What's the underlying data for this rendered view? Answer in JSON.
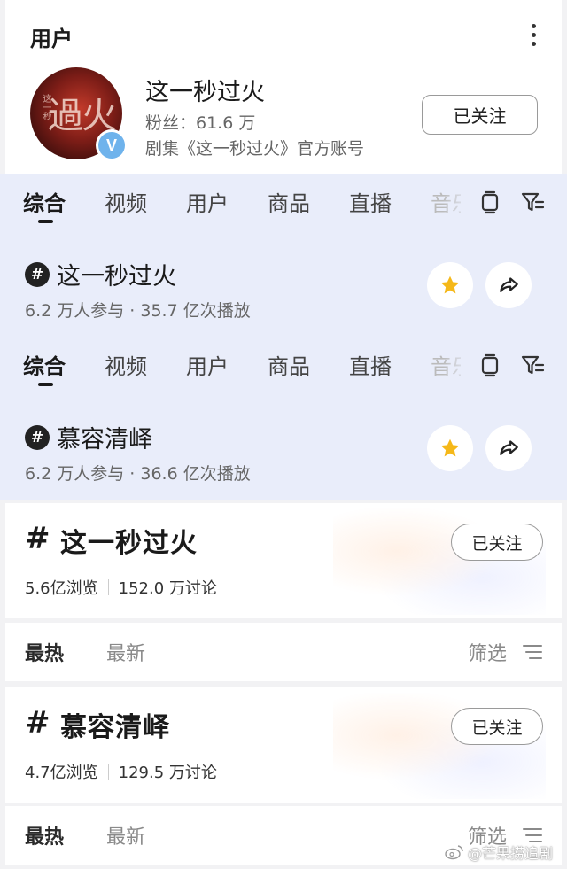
{
  "user_section": {
    "title": "用户",
    "name": "这一秒过火",
    "fans": "粉丝：61.6 万",
    "description": "剧集《这一秒过火》官方账号",
    "follow_label": "已关注",
    "avatar_text": "過火",
    "avatar_small_text": "这一秒",
    "verify_mark": "V"
  },
  "search_panels": [
    {
      "tabs": [
        "综合",
        "视频",
        "用户",
        "商品",
        "直播",
        "音乐"
      ],
      "active_tab": "综合",
      "topic": {
        "hash": "#",
        "name": "这一秒过火",
        "stats": "6.2 万人参与 · 35.7 亿次播放"
      }
    },
    {
      "tabs": [
        "综合",
        "视频",
        "用户",
        "商品",
        "直播",
        "音乐"
      ],
      "active_tab": "综合",
      "topic": {
        "hash": "#",
        "name": "慕容清峄",
        "stats": "6.2 万人参与 · 36.6 亿次播放"
      }
    }
  ],
  "topic_cards": [
    {
      "hash": "#",
      "name": "这一秒过火",
      "views": "5.6亿浏览",
      "discussions": "152.0 万讨论",
      "follow_label": "已关注",
      "sort_hot": "最热",
      "sort_new": "最新",
      "filter_label": "筛选"
    },
    {
      "hash": "#",
      "name": "慕容清峄",
      "views": "4.7亿浏览",
      "discussions": "129.5 万讨论",
      "follow_label": "已关注",
      "sort_hot": "最热",
      "sort_new": "最新",
      "filter_label": "筛选"
    }
  ],
  "watermark": "@芒果捞追剧",
  "icons": [
    "more-vertical-icon",
    "verified-badge-icon",
    "tablet-icon",
    "filter-icon",
    "hashtag-icon",
    "star-icon",
    "share-icon",
    "sort-lines-icon",
    "weibo-logo-icon"
  ],
  "colors": {
    "panel_bg": "#e9edfa",
    "star": "#f5b819",
    "verify": "#6fb3ec"
  }
}
